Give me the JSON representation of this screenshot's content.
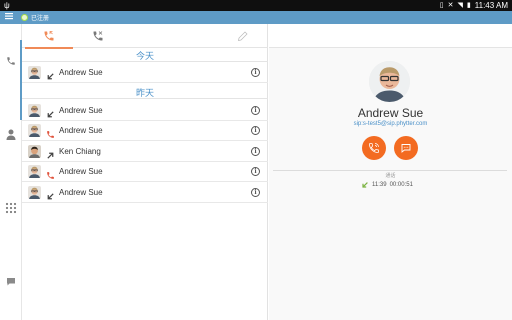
{
  "statusbar": {
    "left_icon": "usb-icon",
    "time": "11:43 AM",
    "icons": [
      "vibrate-icon",
      "mute-icon",
      "wifi-icon",
      "battery-icon"
    ]
  },
  "appbar": {
    "menu_icon": "hamburger-menu-icon",
    "status_text": "已注册",
    "status_color": "#a6e04a",
    "bar_color": "#5e9bc6"
  },
  "sidenav": {
    "items": [
      "phone-icon",
      "contacts-icon",
      "dialpad-icon",
      "chat-icon"
    ],
    "active": "phone-icon"
  },
  "tabs": {
    "items": [
      "all-calls-icon",
      "missed-calls-icon",
      "edit-icon"
    ],
    "active": "all-calls-icon",
    "accent": "#f08a57"
  },
  "call_log": {
    "sections": [
      {
        "title": "今天",
        "rows": [
          {
            "name": "Andrew Sue",
            "direction": "incoming",
            "avatar": "andrew"
          }
        ]
      },
      {
        "title": "昨天",
        "rows": [
          {
            "name": "Andrew Sue",
            "direction": "incoming",
            "avatar": "andrew"
          },
          {
            "name": "Andrew Sue",
            "direction": "missed",
            "avatar": "andrew"
          },
          {
            "name": "Ken Chiang",
            "direction": "outgoing",
            "avatar": "ken"
          },
          {
            "name": "Andrew Sue",
            "direction": "missed",
            "avatar": "andrew"
          },
          {
            "name": "Andrew Sue",
            "direction": "incoming",
            "avatar": "andrew"
          }
        ]
      }
    ]
  },
  "detail": {
    "name": "Andrew Sue",
    "sip": "sip:s-test5@sip.phytter.com",
    "buttons": [
      "call-icon",
      "chat-bubble-icon"
    ],
    "accent": "#f36b21",
    "history_label": "通话",
    "history": [
      {
        "direction": "incoming",
        "time": "11:39",
        "duration": "00:00:51"
      }
    ]
  }
}
